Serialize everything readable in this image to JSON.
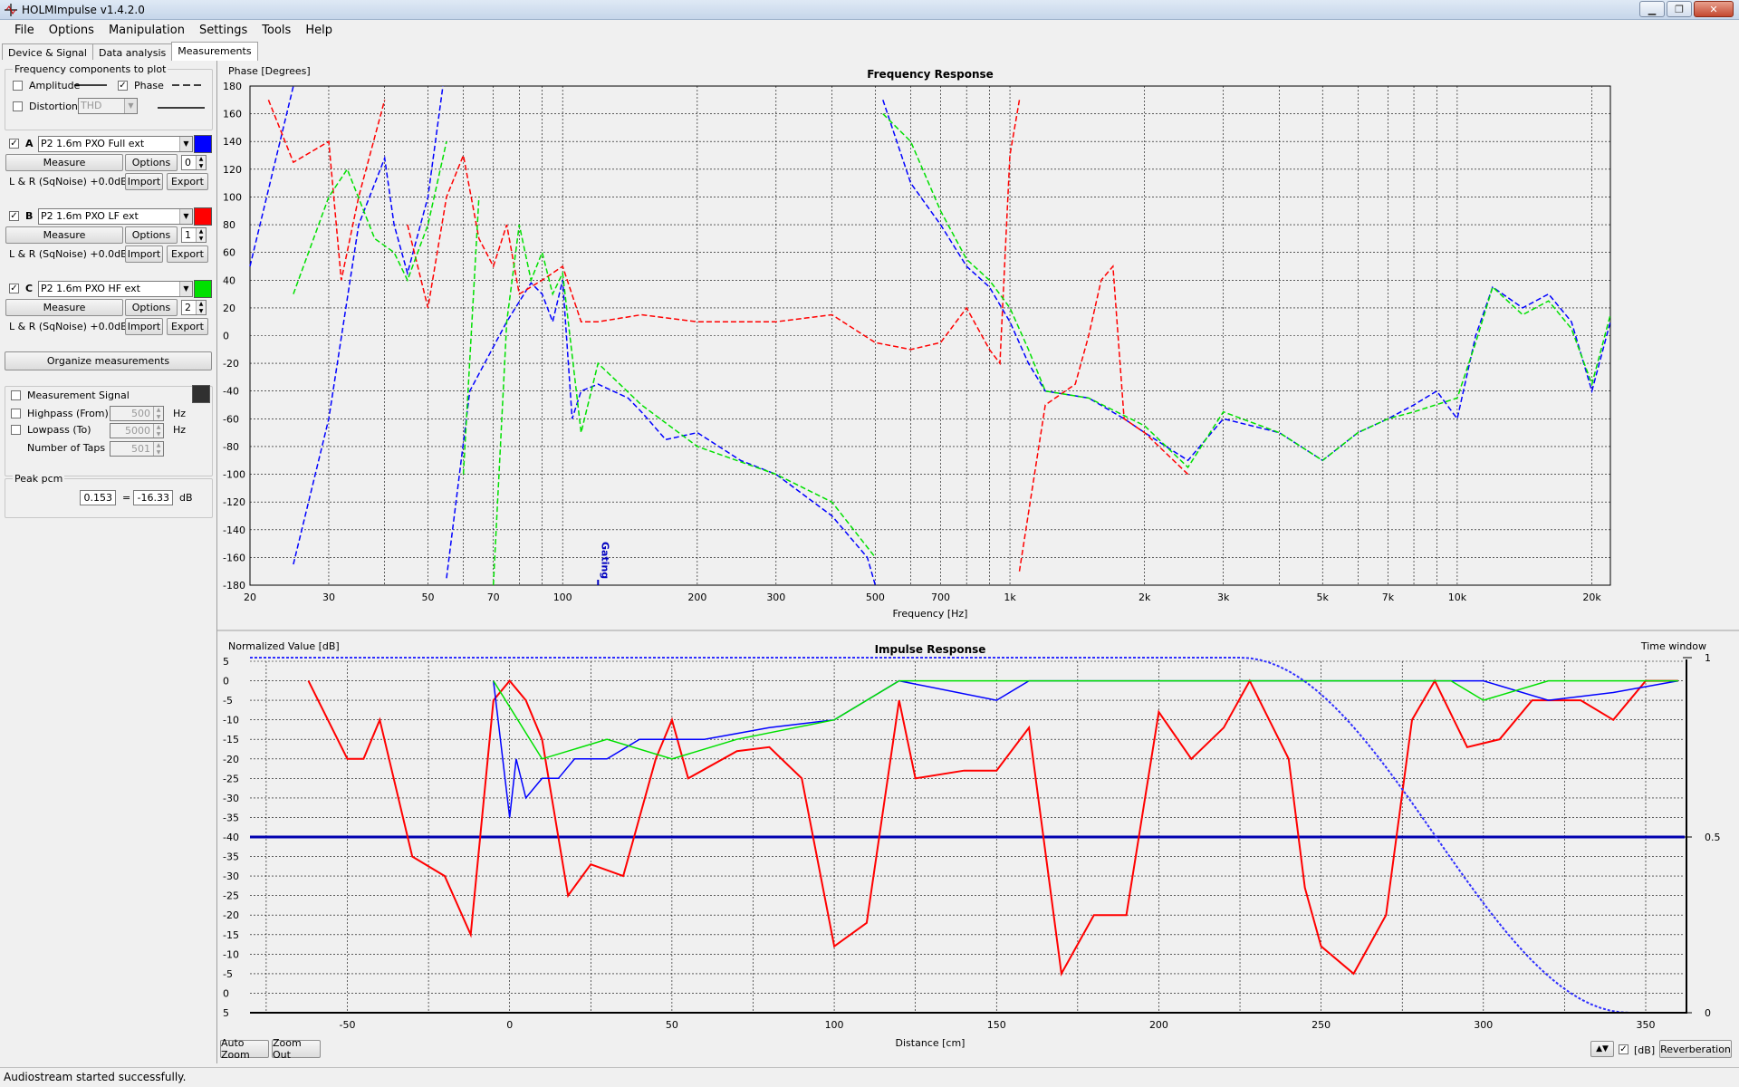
{
  "window": {
    "title": "HOLMImpulse  v1.4.2.0"
  },
  "menu": [
    "File",
    "Options",
    "Manipulation",
    "Settings",
    "Tools",
    "Help"
  ],
  "tabs": [
    "Device & Signal",
    "Data analysis",
    "Measurements"
  ],
  "freq_components": {
    "title": "Frequency components to plot",
    "amplitude": "Amplitude",
    "phase": "Phase",
    "distortion": "Distortion",
    "distortion_type": "THD"
  },
  "measurements": [
    {
      "letter": "A",
      "name": "P2 1.6m PXO Full ext",
      "color": "#0000ff",
      "checked": true,
      "index": "0",
      "info": "L & R (SqNoise) +0.0dB"
    },
    {
      "letter": "B",
      "name": "P2 1.6m PXO LF ext",
      "color": "#ff0000",
      "checked": true,
      "index": "1",
      "info": "L & R (SqNoise) +0.0dB"
    },
    {
      "letter": "C",
      "name": "P2 1.6m PXO HF ext",
      "color": "#00e000",
      "checked": true,
      "index": "2",
      "info": "L & R (SqNoise) +0.0dB"
    }
  ],
  "buttons": {
    "measure": "Measure",
    "options": "Options",
    "import": "Import",
    "export": "Export",
    "organize": "Organize measurements",
    "auto_zoom": "Auto Zoom",
    "zoom_out": "Zoom Out",
    "reverberation": "Reverberation"
  },
  "signal": {
    "title": "Measurement Signal",
    "swatch_color": "#303030",
    "highpass_label": "Highpass (From)",
    "highpass_value": "500",
    "highpass_unit": "Hz",
    "lowpass_label": "Lowpass (To)",
    "lowpass_value": "5000",
    "lowpass_unit": "Hz",
    "taps_label": "Number of Taps",
    "taps_value": "501"
  },
  "peak": {
    "title": "Peak pcm",
    "value": "0.153",
    "eq": "=",
    "db_value": "-16.33",
    "unit": "dB"
  },
  "bottom_controls": {
    "arrows": "▲▼",
    "db_label": "[dB]",
    "db_checked": true
  },
  "status": "Audiostream started successfully.",
  "chart_data": [
    {
      "type": "line",
      "title": "Frequency Response",
      "ylabel": "Phase [Degrees]",
      "xlabel": "Frequency [Hz]",
      "x_scale": "log",
      "xlim": [
        20,
        22000
      ],
      "ylim": [
        -180,
        180
      ],
      "x_ticks": [
        20,
        30,
        50,
        70,
        100,
        200,
        300,
        500,
        700,
        1000,
        2000,
        3000,
        5000,
        7000,
        10000,
        20000
      ],
      "x_tick_labels": [
        "20",
        "30",
        "50",
        "70",
        "100",
        "200",
        "300",
        "500",
        "700",
        "1k",
        "2k",
        "3k",
        "5k",
        "7k",
        "10k",
        "20k"
      ],
      "y_ticks": [
        180,
        160,
        140,
        120,
        100,
        80,
        60,
        40,
        20,
        0,
        -20,
        -40,
        -60,
        -80,
        -100,
        -120,
        -140,
        -160,
        -180
      ],
      "annotation": {
        "text": "Gating",
        "x": 120
      },
      "grid": true,
      "series": [
        {
          "color": "#0000ff",
          "points": [
            [
              20,
              50
            ],
            [
              25,
              180
            ],
            [
              25,
              -165
            ],
            [
              30,
              -60
            ],
            [
              35,
              80
            ],
            [
              40,
              128
            ],
            [
              42,
              80
            ],
            [
              45,
              45
            ],
            [
              50,
              100
            ],
            [
              54,
              180
            ],
            [
              55,
              -175
            ],
            [
              62,
              -40
            ],
            [
              75,
              10
            ],
            [
              85,
              38
            ],
            [
              90,
              30
            ],
            [
              95,
              10
            ],
            [
              100,
              40
            ],
            [
              105,
              -60
            ],
            [
              110,
              -40
            ],
            [
              120,
              -35
            ],
            [
              140,
              -45
            ],
            [
              150,
              -55
            ],
            [
              170,
              -75
            ],
            [
              200,
              -70
            ],
            [
              250,
              -90
            ],
            [
              300,
              -100
            ],
            [
              400,
              -130
            ],
            [
              480,
              -160
            ],
            [
              500,
              -185
            ],
            [
              520,
              170
            ],
            [
              600,
              110
            ],
            [
              700,
              80
            ],
            [
              800,
              50
            ],
            [
              900,
              35
            ],
            [
              1000,
              10
            ],
            [
              1100,
              -20
            ],
            [
              1200,
              -40
            ],
            [
              1500,
              -45
            ],
            [
              1800,
              -60
            ],
            [
              2000,
              -70
            ],
            [
              2500,
              -90
            ],
            [
              3000,
              -60
            ],
            [
              4000,
              -70
            ],
            [
              5000,
              -90
            ],
            [
              6000,
              -70
            ],
            [
              7000,
              -60
            ],
            [
              8000,
              -50
            ],
            [
              9000,
              -40
            ],
            [
              10000,
              -60
            ],
            [
              11000,
              0
            ],
            [
              12000,
              35
            ],
            [
              14000,
              20
            ],
            [
              16000,
              30
            ],
            [
              18000,
              10
            ],
            [
              20000,
              -40
            ],
            [
              22000,
              10
            ]
          ]
        },
        {
          "color": "#ff0000",
          "points": [
            [
              21,
              -170
            ],
            [
              22,
              170
            ],
            [
              25,
              125
            ],
            [
              30,
              140
            ],
            [
              32,
              40
            ],
            [
              35,
              100
            ],
            [
              40,
              170
            ],
            [
              40,
              -170
            ],
            [
              45,
              80
            ],
            [
              50,
              20
            ],
            [
              55,
              100
            ],
            [
              60,
              130
            ],
            [
              65,
              70
            ],
            [
              70,
              50
            ],
            [
              75,
              80
            ],
            [
              80,
              30
            ],
            [
              90,
              40
            ],
            [
              100,
              50
            ],
            [
              110,
              10
            ],
            [
              120,
              10
            ],
            [
              150,
              15
            ],
            [
              200,
              10
            ],
            [
              300,
              10
            ],
            [
              400,
              15
            ],
            [
              500,
              -5
            ],
            [
              600,
              -10
            ],
            [
              700,
              -5
            ],
            [
              800,
              20
            ],
            [
              900,
              -10
            ],
            [
              950,
              -20
            ],
            [
              1000,
              130
            ],
            [
              1050,
              170
            ],
            [
              1050,
              -170
            ],
            [
              1200,
              -50
            ],
            [
              1400,
              -35
            ],
            [
              1500,
              0
            ],
            [
              1600,
              40
            ],
            [
              1700,
              50
            ],
            [
              1800,
              -60
            ],
            [
              2000,
              -70
            ],
            [
              2500,
              -100
            ]
          ]
        },
        {
          "color": "#00e000",
          "points": [
            [
              20,
              -180
            ],
            [
              25,
              30
            ],
            [
              30,
              100
            ],
            [
              33,
              120
            ],
            [
              38,
              70
            ],
            [
              42,
              60
            ],
            [
              45,
              40
            ],
            [
              50,
              80
            ],
            [
              55,
              140
            ],
            [
              60,
              -100
            ],
            [
              65,
              100
            ],
            [
              70,
              -180
            ],
            [
              75,
              10
            ],
            [
              80,
              80
            ],
            [
              85,
              40
            ],
            [
              90,
              60
            ],
            [
              95,
              30
            ],
            [
              100,
              45
            ],
            [
              110,
              -70
            ],
            [
              120,
              -20
            ],
            [
              150,
              -50
            ],
            [
              200,
              -80
            ],
            [
              300,
              -100
            ],
            [
              400,
              -120
            ],
            [
              500,
              -160
            ],
            [
              520,
              160
            ],
            [
              600,
              140
            ],
            [
              700,
              90
            ],
            [
              800,
              55
            ],
            [
              900,
              40
            ],
            [
              1000,
              20
            ],
            [
              1100,
              -10
            ],
            [
              1200,
              -40
            ],
            [
              1500,
              -45
            ],
            [
              2000,
              -65
            ],
            [
              2500,
              -95
            ],
            [
              3000,
              -55
            ],
            [
              4000,
              -70
            ],
            [
              5000,
              -90
            ],
            [
              6000,
              -70
            ],
            [
              7000,
              -60
            ],
            [
              8000,
              -55
            ],
            [
              10000,
              -45
            ],
            [
              11000,
              -5
            ],
            [
              12000,
              35
            ],
            [
              14000,
              15
            ],
            [
              16000,
              25
            ],
            [
              18000,
              5
            ],
            [
              20000,
              -35
            ],
            [
              22000,
              15
            ]
          ]
        }
      ]
    },
    {
      "type": "line",
      "title": "Impulse Response",
      "ylabel": "Normalized Value [dB]",
      "y2label": "Time window",
      "xlabel": "Distance [cm]",
      "xlim": [
        -80,
        362
      ],
      "x_ticks": [
        -50,
        0,
        50,
        100,
        150,
        200,
        250,
        300,
        350
      ],
      "y_tick_labels": [
        "5",
        "0",
        "-5",
        "-10",
        "-15",
        "-20",
        "-25",
        "-30",
        "-35",
        "-40",
        "-35",
        "-30",
        "-25",
        "-20",
        "-15",
        "-10",
        "-5",
        "0",
        "5"
      ],
      "y2_tick_labels": [
        "1",
        "0.5",
        "0"
      ],
      "grid": true,
      "window_curve": {
        "color": "#3030ff",
        "flat_until": 225,
        "zero_at": 345
      },
      "series": [
        {
          "color": "#ff0000",
          "points": [
            [
              -62,
              0
            ],
            [
              -50,
              -20
            ],
            [
              -45,
              -20
            ],
            [
              -40,
              -10
            ],
            [
              -30,
              -35
            ],
            [
              -20,
              -30
            ],
            [
              -12,
              -15
            ],
            [
              -5,
              -5
            ],
            [
              0,
              0
            ],
            [
              5,
              -5
            ],
            [
              10,
              -15
            ],
            [
              18,
              -25
            ],
            [
              25,
              -33
            ],
            [
              35,
              -30
            ],
            [
              45,
              -20
            ],
            [
              50,
              -10
            ],
            [
              55,
              -25
            ],
            [
              70,
              -18
            ],
            [
              80,
              -17
            ],
            [
              90,
              -25
            ],
            [
              100,
              -12
            ],
            [
              110,
              -18
            ],
            [
              120,
              -5
            ],
            [
              125,
              -25
            ],
            [
              140,
              -23
            ],
            [
              150,
              -23
            ],
            [
              160,
              -12
            ],
            [
              170,
              -5
            ],
            [
              180,
              -20
            ],
            [
              190,
              -20
            ],
            [
              200,
              -8
            ],
            [
              210,
              -20
            ],
            [
              220,
              -12
            ],
            [
              228,
              0
            ],
            [
              240,
              -20
            ],
            [
              245,
              -27
            ],
            [
              250,
              -12
            ],
            [
              260,
              -5
            ],
            [
              270,
              -20
            ],
            [
              278,
              -10
            ],
            [
              285,
              0
            ],
            [
              295,
              -17
            ],
            [
              305,
              -15
            ],
            [
              315,
              -5
            ],
            [
              330,
              -5
            ],
            [
              340,
              -10
            ],
            [
              350,
              0
            ],
            [
              360,
              0
            ]
          ]
        },
        {
          "color": "#0000ff",
          "points": [
            [
              -5,
              0
            ],
            [
              0,
              -35
            ],
            [
              2,
              -20
            ],
            [
              5,
              -30
            ],
            [
              10,
              -25
            ],
            [
              15,
              -25
            ],
            [
              20,
              -20
            ],
            [
              30,
              -20
            ],
            [
              40,
              -15
            ],
            [
              60,
              -15
            ],
            [
              80,
              -12
            ],
            [
              100,
              -10
            ],
            [
              110,
              -5
            ],
            [
              120,
              0
            ],
            [
              150,
              -5
            ],
            [
              160,
              0
            ],
            [
              300,
              0
            ],
            [
              320,
              -5
            ],
            [
              340,
              -3
            ],
            [
              360,
              0
            ]
          ]
        },
        {
          "color": "#00e000",
          "points": [
            [
              -5,
              0
            ],
            [
              10,
              -20
            ],
            [
              30,
              -15
            ],
            [
              50,
              -20
            ],
            [
              70,
              -15
            ],
            [
              100,
              -10
            ],
            [
              120,
              0
            ],
            [
              200,
              0
            ],
            [
              290,
              0
            ],
            [
              300,
              -5
            ],
            [
              320,
              0
            ],
            [
              360,
              0
            ]
          ]
        }
      ]
    }
  ]
}
